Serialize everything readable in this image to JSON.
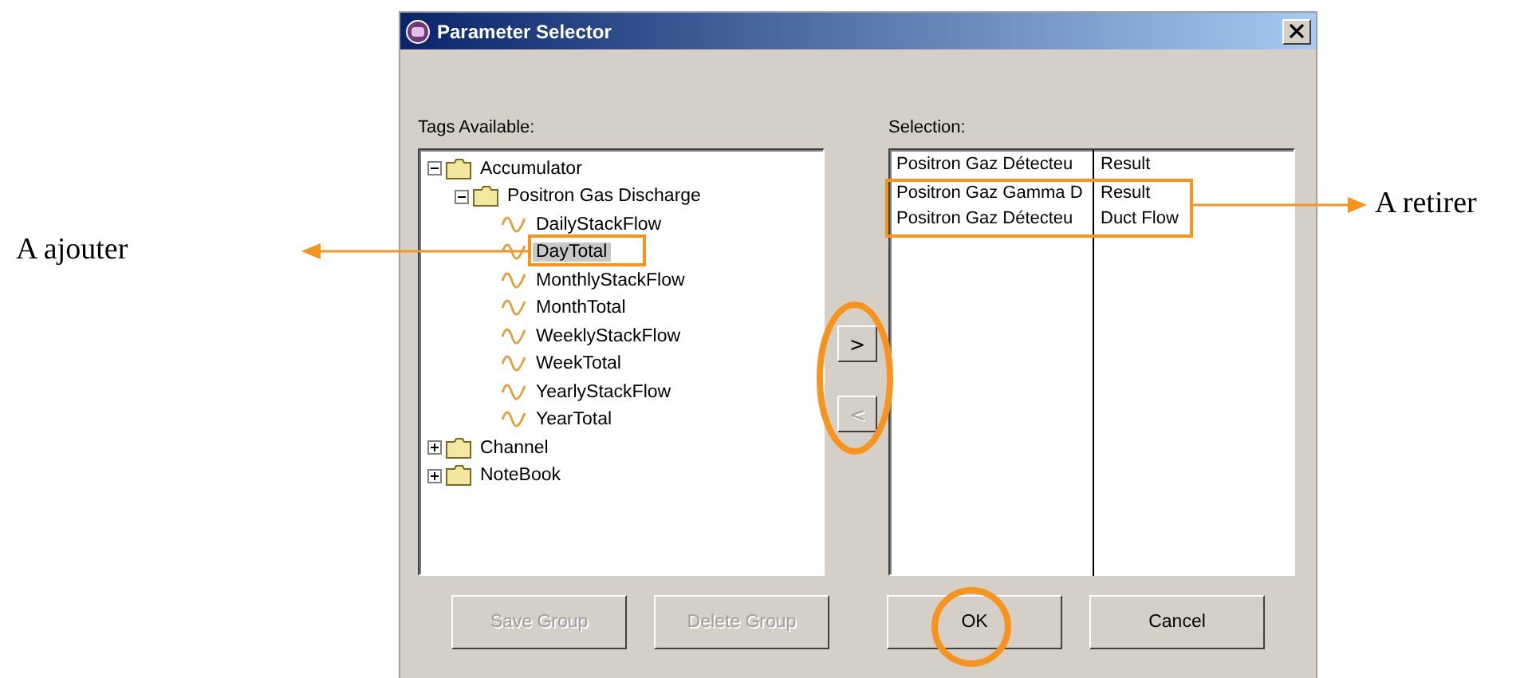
{
  "window": {
    "title": "Parameter Selector"
  },
  "tags_label": "Tags Available:",
  "tree": [
    {
      "label": "Accumulator",
      "kind": "folder",
      "expanded": true,
      "selected": false,
      "children": [
        {
          "label": "Positron Gas Discharge",
          "kind": "folder",
          "expanded": true,
          "selected": false,
          "children": [
            {
              "label": "DailyStackFlow",
              "kind": "tag",
              "selected": false
            },
            {
              "label": "DayTotal",
              "kind": "tag",
              "selected": true
            },
            {
              "label": "MonthlyStackFlow",
              "kind": "tag",
              "selected": false
            },
            {
              "label": "MonthTotal",
              "kind": "tag",
              "selected": false
            },
            {
              "label": "WeeklyStackFlow",
              "kind": "tag",
              "selected": false
            },
            {
              "label": "WeekTotal",
              "kind": "tag",
              "selected": false
            },
            {
              "label": "YearlyStackFlow",
              "kind": "tag",
              "selected": false
            },
            {
              "label": "YearTotal",
              "kind": "tag",
              "selected": false
            }
          ]
        }
      ]
    },
    {
      "label": "Channel",
      "kind": "folder",
      "expanded": false,
      "selected": false
    },
    {
      "label": "NoteBook",
      "kind": "folder",
      "expanded": false,
      "selected": false
    }
  ],
  "move_buttons": [
    {
      "label": ">",
      "disabled": false
    },
    {
      "label": "<",
      "disabled": true
    }
  ],
  "selection_label": "Selection:",
  "selection_rows": [
    {
      "cells": [
        "Positron Gaz Détecteu",
        "Result"
      ]
    },
    {
      "cells": [
        "Positron Gaz Gamma D",
        "Result"
      ]
    },
    {
      "cells": [
        "Positron Gaz Détecteu",
        "Duct Flow"
      ]
    }
  ],
  "buttons": [
    {
      "label": "Save Group",
      "disabled": true
    },
    {
      "label": "Delete Group",
      "disabled": true
    },
    {
      "label": "OK",
      "disabled": false
    },
    {
      "label": "Cancel",
      "disabled": false
    }
  ],
  "annotations": [
    {
      "text": "A ajouter"
    },
    {
      "text": "A retirer"
    }
  ]
}
